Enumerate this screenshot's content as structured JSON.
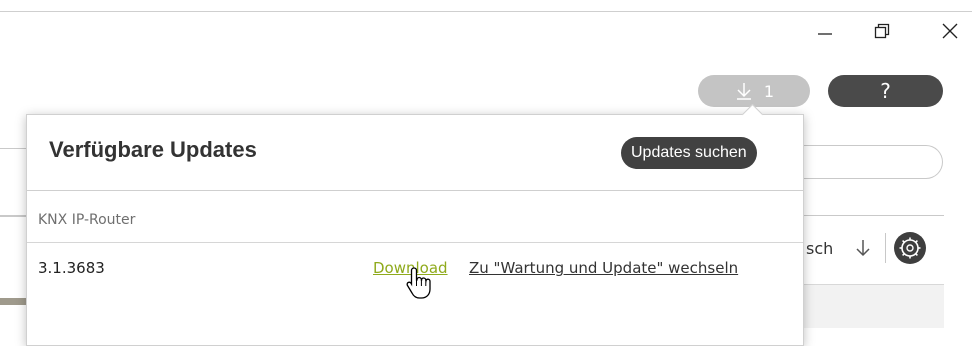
{
  "window": {
    "minimize_icon": "minimize-icon",
    "restore_icon": "restore-icon",
    "close_icon": "close-icon"
  },
  "header": {
    "downloads_count": "1",
    "help_label": "?"
  },
  "background": {
    "sort_label": "sch"
  },
  "popover": {
    "title": "Verfügbare Updates",
    "search_button": "Updates suchen",
    "group_label": "KNX IP-Router",
    "version": "3.1.3683",
    "download_link": "Download",
    "maintenance_link": "Zu \"Wartung und Update\" wechseln"
  },
  "colors": {
    "download_link": "#8faa1c",
    "dark_button": "#414141",
    "disabled_pill": "#c4c4c4"
  }
}
